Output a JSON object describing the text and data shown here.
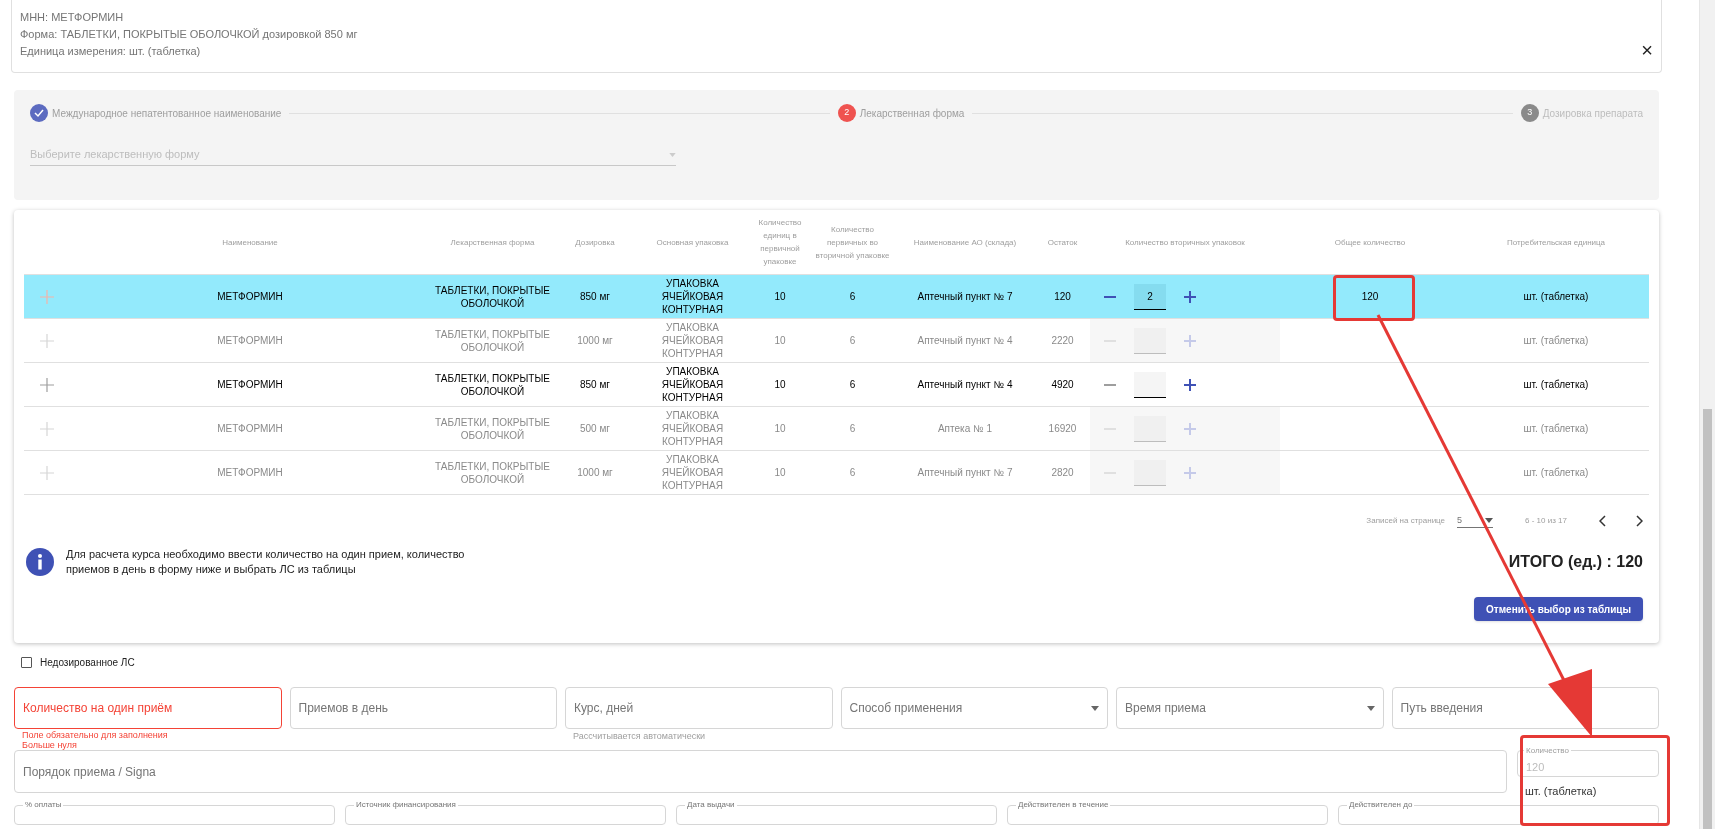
{
  "drug_info": {
    "lines": [
      "МНН: МЕТФОРМИН",
      "Форма: ТАБЛЕТКИ, ПОКРЫТЫЕ ОБОЛОЧКОЙ дозировкой 850 мг",
      "Единица измерения: шт. (таблетка)"
    ],
    "close": "×"
  },
  "stepper": {
    "steps": [
      {
        "kind": "done",
        "label": "Международное непатентованное наименование"
      },
      {
        "kind": "error",
        "number": "2",
        "label": "Лекарственная форма"
      },
      {
        "kind": "pending",
        "number": "3",
        "label": "Дозировка препарата"
      }
    ],
    "select": {
      "placeholder": "Выберите лекарственную форму"
    }
  },
  "table": {
    "columns": [
      "Наименование",
      "Лекарственная форма",
      "Дозировка",
      "Основная упаковка",
      "Количество единиц в первичной упаковке",
      "Количество первичных во вторичной упаковке",
      "Наименование АО (склада)",
      "Остаток",
      "Количество вторичных упаковок",
      "Общее количество",
      "Потребительская единица"
    ],
    "rows": [
      {
        "selected": true,
        "disabled": false,
        "name": "МЕТФОРМИН",
        "form": "ТАБЛЕТКИ, ПОКРЫТЫЕ ОБОЛОЧКОЙ",
        "dosage": "850 мг",
        "package": "УПАКОВКА ЯЧЕЙКОВАЯ КОНТУРНАЯ",
        "units_in_primary": "10",
        "primary_in_secondary": "6",
        "warehouse": "Аптечный пункт № 7",
        "stock": "120",
        "secondary_count": "2",
        "total": "120",
        "unit": "шт. (таблетка)"
      },
      {
        "selected": false,
        "disabled": true,
        "name": "МЕТФОРМИН",
        "form": "ТАБЛЕТКИ, ПОКРЫТЫЕ ОБОЛОЧКОЙ",
        "dosage": "1000 мг",
        "package": "УПАКОВКА ЯЧЕЙКОВАЯ КОНТУРНАЯ",
        "units_in_primary": "10",
        "primary_in_secondary": "6",
        "warehouse": "Аптечный пункт № 4",
        "stock": "2220",
        "unit": "шт. (таблетка)"
      },
      {
        "selected": false,
        "disabled": false,
        "name": "МЕТФОРМИН",
        "form": "ТАБЛЕТКИ, ПОКРЫТЫЕ ОБОЛОЧКОЙ",
        "dosage": "850 мг",
        "package": "УПАКОВКА ЯЧЕЙКОВАЯ КОНТУРНАЯ",
        "units_in_primary": "10",
        "primary_in_secondary": "6",
        "warehouse": "Аптечный пункт № 4",
        "stock": "4920",
        "unit": "шт. (таблетка)"
      },
      {
        "selected": false,
        "disabled": true,
        "name": "МЕТФОРМИН",
        "form": "ТАБЛЕТКИ, ПОКРЫТЫЕ ОБОЛОЧКОЙ",
        "dosage": "500 мг",
        "package": "УПАКОВКА ЯЧЕЙКОВАЯ КОНТУРНАЯ",
        "units_in_primary": "10",
        "primary_in_secondary": "6",
        "warehouse": "Аптека № 1",
        "stock": "16920",
        "unit": "шт. (таблетка)"
      },
      {
        "selected": false,
        "disabled": true,
        "name": "МЕТФОРМИН",
        "form": "ТАБЛЕТКИ, ПОКРЫТЫЕ ОБОЛОЧКОЙ",
        "dosage": "1000 мг",
        "package": "УПАКОВКА ЯЧЕЙКОВАЯ КОНТУРНАЯ",
        "units_in_primary": "10",
        "primary_in_secondary": "6",
        "warehouse": "Аптечный пункт № 7",
        "stock": "2820",
        "unit": "шт. (таблетка)"
      }
    ],
    "pagination": {
      "label": "Записей на странице",
      "per_page": "5",
      "range": "6 - 10 из 17"
    }
  },
  "info": "Для расчета курса необходимо ввести количество на один прием, количество приемов в день в форму ниже и выбрать ЛС из таблицы",
  "total": "ИТОГО (ед.) : 120",
  "cancel_button": "Отменить выбор из таблицы",
  "undosed": {
    "label": "Недозированное ЛС",
    "checked": false
  },
  "fields": [
    {
      "kind": "text",
      "placeholder": "Количество на один приём",
      "error": true,
      "helper": [
        "Поле обязательно для заполнения",
        "Больше нуля"
      ]
    },
    {
      "kind": "text",
      "placeholder": "Приемов в день",
      "error": false
    },
    {
      "kind": "text",
      "placeholder": "Курс, дней",
      "error": false,
      "helper": [
        "Рассчитывается автоматически"
      ]
    },
    {
      "kind": "select",
      "placeholder": "Способ применения",
      "error": false
    },
    {
      "kind": "select",
      "placeholder": "Время приема",
      "error": false
    },
    {
      "kind": "text",
      "placeholder": "Путь введения",
      "error": false
    }
  ],
  "signa": {
    "placeholder": "Порядок приема / Signa"
  },
  "quantity": {
    "label": "Количество",
    "value": "120",
    "unit": "шт. (таблетка)"
  },
  "bottom_fields": [
    "% оплаты",
    "Источник финансирования",
    "Дата выдачи",
    "Действителен в течение",
    "Действителен до"
  ]
}
